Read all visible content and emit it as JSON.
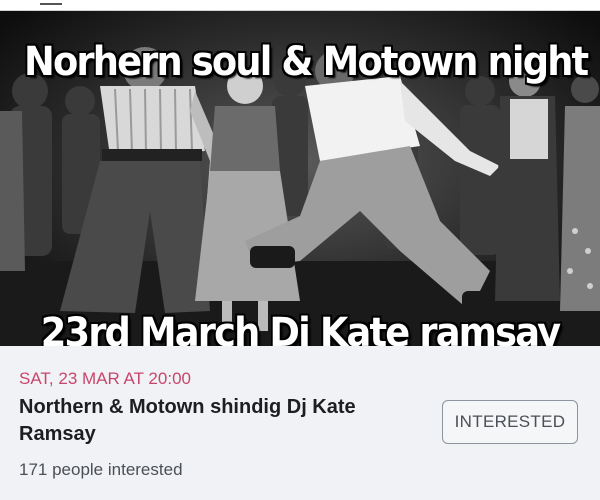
{
  "poster": {
    "line1": "Norhern soul & Motown night",
    "line2": "23rd March Dj Kate ramsay"
  },
  "event": {
    "date": "SAT, 23 MAR AT 20:00",
    "title": "Northern & Motown shindig Dj Kate Ramsay",
    "interested_count": "171 people interested"
  },
  "actions": {
    "interested_label": "INTERESTED"
  },
  "colors": {
    "date": "#c8466b",
    "panel_bg": "#f0f2f5",
    "title": "#1c1e21"
  }
}
